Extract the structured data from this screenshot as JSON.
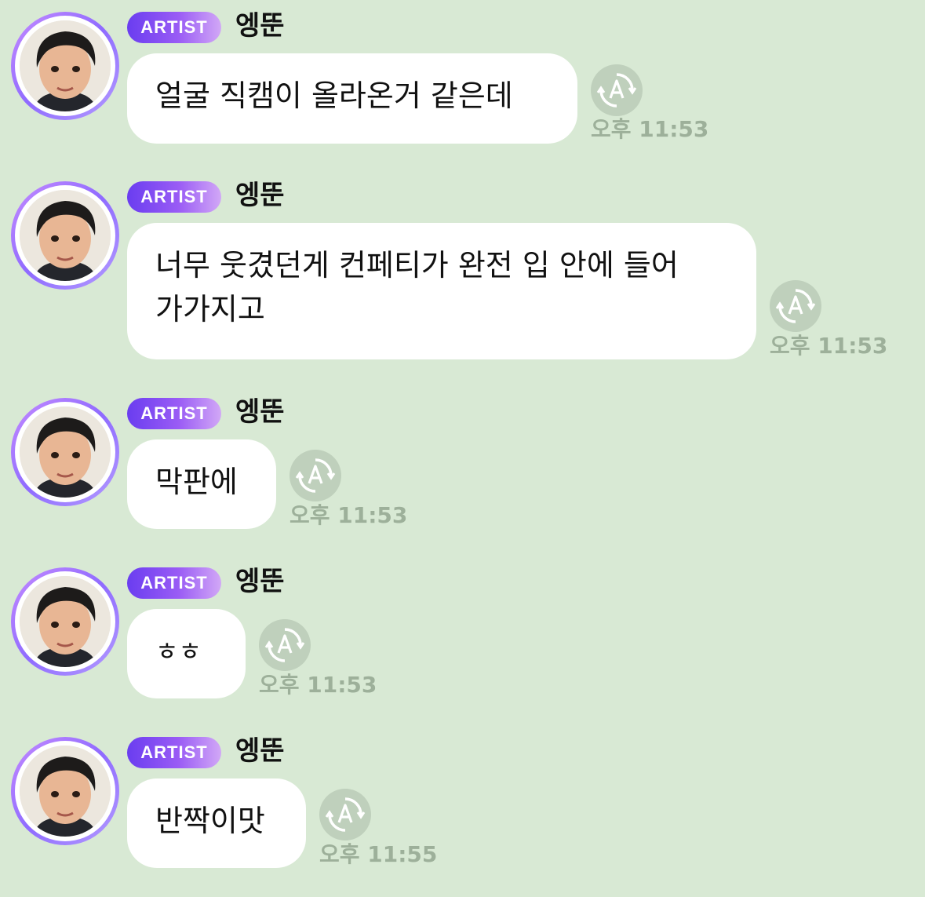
{
  "messages": [
    {
      "badge": "ARTIST",
      "sender": "엥뚠",
      "text": "얼굴 직캠이 올라온거 같은데",
      "time": "오후 11:53"
    },
    {
      "badge": "ARTIST",
      "sender": "엥뚠",
      "text": "너무 웃겼던게 컨페티가 완전 입 안에 들어\n가가지고",
      "time": "오후 11:53"
    },
    {
      "badge": "ARTIST",
      "sender": "엥뚠",
      "text": "막판에",
      "time": "오후 11:53"
    },
    {
      "badge": "ARTIST",
      "sender": "엥뚠",
      "text": "ㅎㅎ",
      "time": "오후 11:53"
    },
    {
      "badge": "ARTIST",
      "sender": "엥뚠",
      "text": "반짝이맛",
      "time": "오후 11:55"
    }
  ],
  "icons": {
    "avatar": "profile-photo",
    "translate": "auto-translate-icon"
  },
  "colors": {
    "background": "#d8e9d4",
    "bubble": "#ffffff",
    "badge_start": "#6a3df0",
    "badge_end": "#d2a8f6",
    "timestamp": "#9db09a",
    "translate_icon_bg": "#bfd0bc"
  }
}
